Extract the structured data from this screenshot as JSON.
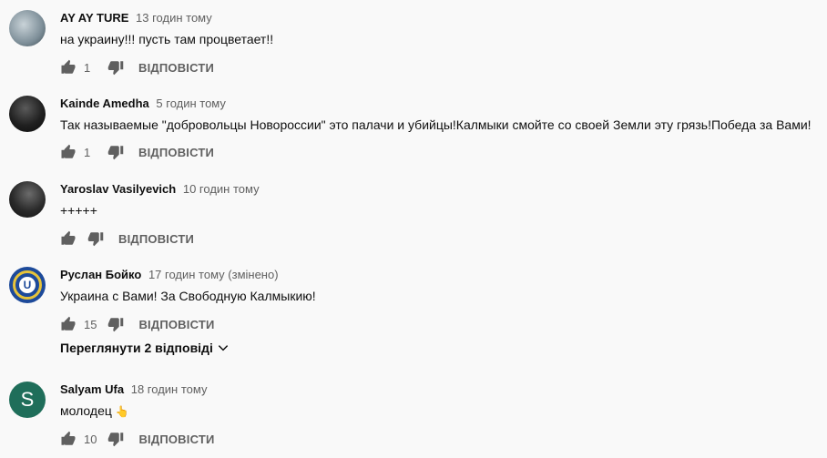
{
  "comments": [
    {
      "author": "AY AY TURE",
      "time": "13 годин тому",
      "text": "на украину!!! пусть там процветает!!",
      "likes": "1",
      "reply_label": "ВІДПОВІСТИ",
      "avatar_icon": "landscape-avatar"
    },
    {
      "author": "Kainde Amedha",
      "time": "5 годин тому",
      "text": "Так называемые \"добровольцы Новороссии\" это палачи и убийцы!Калмыки смойте со своей Земли эту грязь!Победа за Вами!",
      "likes": "1",
      "reply_label": "ВІДПОВІСТИ",
      "avatar_icon": "dark-portrait-avatar"
    },
    {
      "author": "Yaroslav Vasilyevich",
      "time": "10 годин тому",
      "text": "+++++",
      "likes": "",
      "reply_label": "ВІДПОВІСТИ",
      "avatar_icon": "hooded-figure-avatar"
    },
    {
      "author": "Руслан Бойко",
      "time": "17 годин тому (змінено)",
      "text": "Украина с Вами! За Свободную Калмыкию!",
      "likes": "15",
      "reply_label": "ВІДПОВІСТИ",
      "avatar_icon": "emblem-avatar",
      "avatar_letter": "U",
      "view_replies": "Переглянути 2 відповіді"
    },
    {
      "author": "Salyam Ufa",
      "time": "18 годин тому",
      "text": "молодец",
      "emoji": "👆",
      "likes": "10",
      "reply_label": "ВІДПОВІСТИ",
      "avatar_icon": "letter-avatar",
      "avatar_letter": "S"
    }
  ],
  "colors": {
    "background": "#f9f9f9",
    "secondary_text": "#606060",
    "primary_text": "#0f0f0f"
  }
}
